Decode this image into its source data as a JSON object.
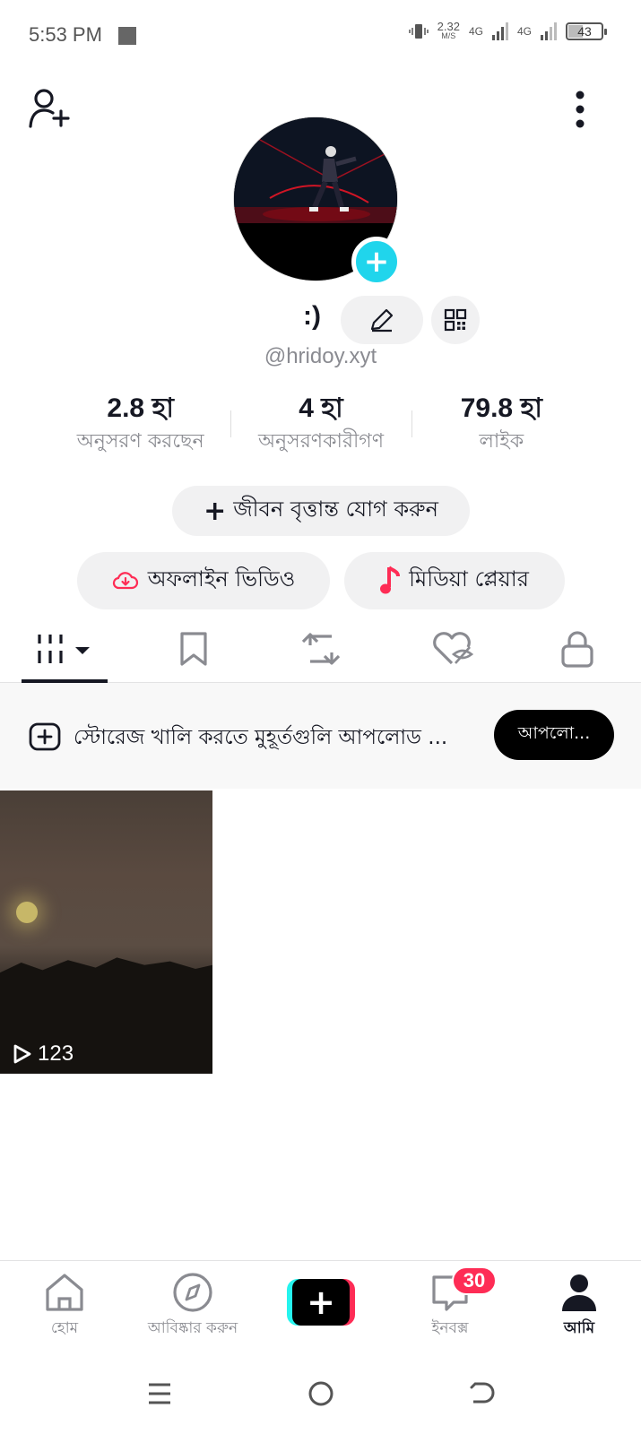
{
  "status_bar": {
    "time": "5:53 PM",
    "speed_value": "2.32",
    "speed_unit": "M/S",
    "network_1": "4G",
    "network_2": "4G",
    "battery": "43"
  },
  "profile": {
    "name": ":)",
    "handle": "@hridoy.xyt"
  },
  "stats": [
    {
      "value": "2.8 হা",
      "label": "অনুসরণ করছেন"
    },
    {
      "value": "4 হা",
      "label": "অনুসরণকারীগণ"
    },
    {
      "value": "79.8 হা",
      "label": "লাইক"
    }
  ],
  "bio_button": {
    "label": "জীবন বৃত্তান্ত যোগ করুন"
  },
  "pills": {
    "offline_label": "অফলাইন ভিডিও",
    "media_label": "মিডিয়া প্লেয়ার"
  },
  "banner": {
    "text": "স্টোরেজ খালি করতে মুহূর্তগুলি আপলোড ...",
    "button": "আপলো..."
  },
  "video": {
    "views": "123"
  },
  "bottom_nav": {
    "home": "হোম",
    "discover": "আবিষ্কার করুন",
    "inbox": "ইনবক্স",
    "inbox_badge": "30",
    "me": "আমি"
  },
  "colors": {
    "accent_cyan": "#20d5ec",
    "accent_red": "#fe2c55",
    "text_primary": "#161823",
    "text_secondary": "#8a8b91"
  }
}
